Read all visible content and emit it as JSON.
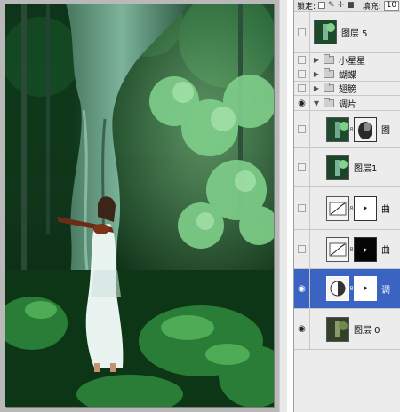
{
  "toolbar": {
    "lock_label": "锁定:",
    "fill_label": "填充:",
    "fill_value": "10"
  },
  "layers": [
    {
      "name": "图层 5",
      "visible": false,
      "type": "layer"
    },
    {
      "name": "小星星",
      "visible": false,
      "type": "group",
      "expanded": false
    },
    {
      "name": "蝴蝶",
      "visible": false,
      "type": "group",
      "expanded": false
    },
    {
      "name": "翅膀",
      "visible": false,
      "type": "group",
      "expanded": false
    },
    {
      "name": "调片",
      "visible": true,
      "type": "group",
      "expanded": true
    },
    {
      "name": "图",
      "visible": false,
      "type": "layer-with-mask"
    },
    {
      "name": "图层1",
      "visible": false,
      "type": "layer"
    },
    {
      "name": "曲",
      "visible": false,
      "type": "adjustment"
    },
    {
      "name": "曲",
      "visible": false,
      "type": "adjustment"
    },
    {
      "name": "调",
      "visible": true,
      "type": "adjustment",
      "selected": true
    },
    {
      "name": "图层 0",
      "visible": true,
      "type": "layer"
    }
  ],
  "colors": {
    "selection": "#3a63c2",
    "panel_bg": "#ececec",
    "canvas_bg": "#b9b9b9"
  }
}
